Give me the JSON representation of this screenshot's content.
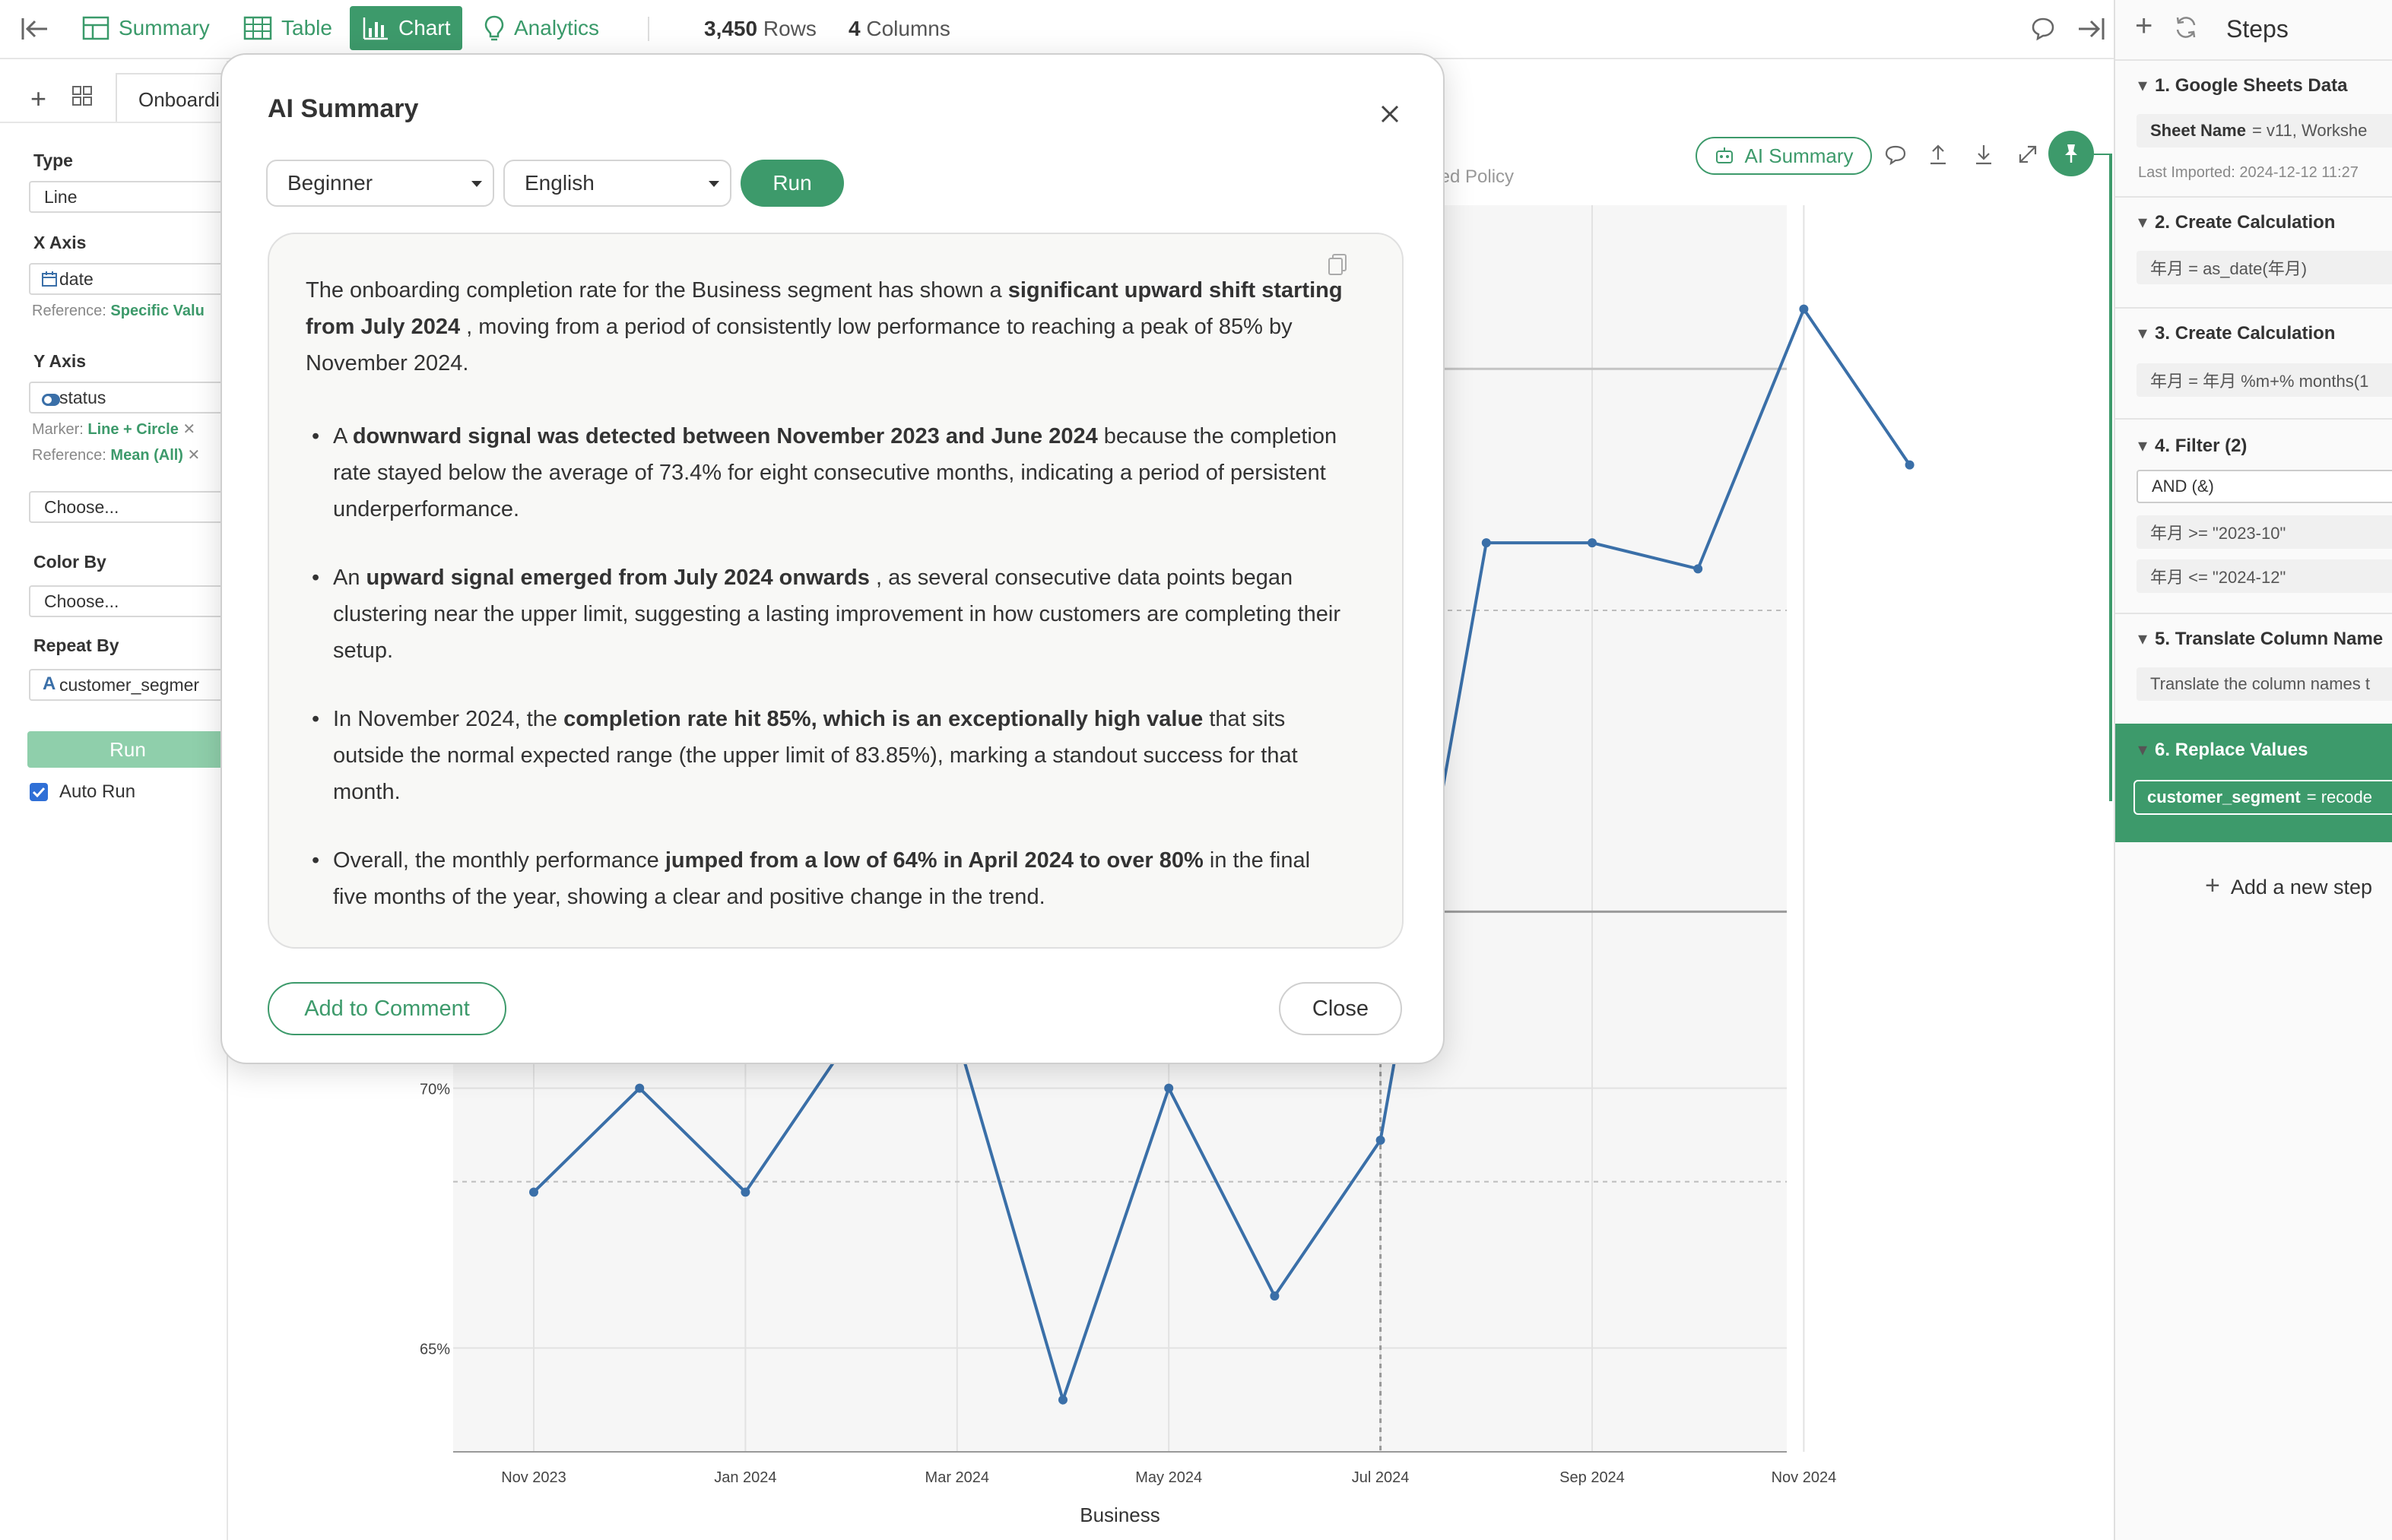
{
  "toolbar": {
    "summary": "Summary",
    "table": "Table",
    "chart": "Chart",
    "analytics": "Analytics",
    "rows_count": "3,450",
    "rows_label": "Rows",
    "cols_count": "4",
    "cols_label": "Columns"
  },
  "left_panel": {
    "tab_label": "Onboardi",
    "type_label": "Type",
    "type_value": "Line",
    "x_axis_label": "X Axis",
    "x_axis_value": "date",
    "x_ref_label": "Reference:",
    "x_ref_value": "Specific Valu",
    "y_axis_label": "Y Axis",
    "y_axis_value": "status",
    "marker_label": "Marker:",
    "marker_value": "Line + Circle",
    "y_ref_label": "Reference:",
    "y_ref_value": "Mean (All)",
    "choose_1": "Choose...",
    "color_by_label": "Color By",
    "choose_2": "Choose...",
    "repeat_by_label": "Repeat By",
    "repeat_by_value": "customer_segmer",
    "run_label": "Run",
    "auto_run_label": "Auto Run"
  },
  "chart_header": {
    "ai_summary_label": "AI Summary"
  },
  "chart_data": {
    "type": "line",
    "xlabel": "Business",
    "x": [
      "Nov 2023",
      "Dec 2023",
      "Jan 2024",
      "Feb 2024",
      "Mar 2024",
      "Apr 2024",
      "May 2024",
      "Jun 2024",
      "Jul 2024",
      "Aug 2024",
      "Sep 2024",
      "Oct 2024",
      "Nov 2024",
      "Dec 2024"
    ],
    "x_tick_labels": [
      "Nov 2023",
      "Jan 2024",
      "Mar 2024",
      "May 2024",
      "Jul 2024",
      "Sep 2024",
      "Nov 2024"
    ],
    "series": [
      {
        "values": [
          68.0,
          70.0,
          68.0,
          71.0,
          71.0,
          64.0,
          70.0,
          66.0,
          69.0,
          80.5,
          80.5,
          80.0,
          85.0,
          82.0
        ]
      }
    ],
    "y_tick_values": [
      65,
      70
    ],
    "y_tick_labels": [
      "65%",
      "70%"
    ],
    "ylim": [
      63,
      87
    ],
    "mean": 73.4,
    "upper_limit": 83.85,
    "lower_limit": 68.2,
    "upper_inner_band": 79.2,
    "annotation": {
      "x": "Jul 2024",
      "label": "Updated Policy"
    },
    "grid": true,
    "line_color": "#3a6fa8"
  },
  "modal": {
    "title": "AI Summary",
    "level_value": "Beginner",
    "language_value": "English",
    "run_label": "Run",
    "intro": {
      "t1": "The onboarding completion rate for the Business segment has shown a ",
      "b1": "significant upward shift starting from July 2024",
      "t2": " , moving from a period of consistently low performance to reaching a peak of 85% by November 2024."
    },
    "bullets": [
      {
        "t1": "A ",
        "b1": "downward signal was detected between November 2023 and June 2024",
        "t2": " because the completion rate stayed below the average of 73.4% for eight consecutive months, indicating a period of persistent underperformance."
      },
      {
        "t1": "An ",
        "b1": "upward signal emerged from July 2024 onwards",
        "t2": " , as several consecutive data points began clustering near the upper limit, suggesting a lasting improvement in how customers are completing their setup."
      },
      {
        "t1": "In November 2024, the ",
        "b1": "completion rate hit 85%, which is an exceptionally high value",
        "t2": " that sits outside the normal expected range (the upper limit of 83.85%), marking a standout success for that month."
      },
      {
        "t1": "Overall, the monthly performance ",
        "b1": "jumped from a low of 64% in April 2024 to over 80%",
        "t2": " in the final five months of the year, showing a clear and positive change in the trend."
      }
    ],
    "add_comment_label": "Add to Comment",
    "close_label": "Close"
  },
  "steps": {
    "title": "Steps",
    "s1_title": "1. Google Sheets Data",
    "s1_key": "Sheet Name",
    "s1_val": "= v11, Workshe",
    "s1_meta": "Last Imported: 2024-12-12 11:27",
    "s2_title": "2. Create Calculation",
    "s2_chip": "年月 = as_date(年月)",
    "s3_title": "3. Create Calculation",
    "s3_chip": "年月 = 年月 %m+% months(1",
    "s4_title": "4. Filter (2)",
    "s4_and": "AND (&)",
    "s4_c1": "年月 >= \"2023-10\"",
    "s4_c2": "年月 <= \"2024-12\"",
    "s5_title": "5. Translate Column Name",
    "s5_chip": "Translate the column names t",
    "s6_title": "6. Replace Values",
    "s6_key": "customer_segment",
    "s6_val": "= recode",
    "add_step": "Add a new step"
  },
  "colors": {
    "accent": "#3d9a6b",
    "line": "#3a6fa8"
  }
}
